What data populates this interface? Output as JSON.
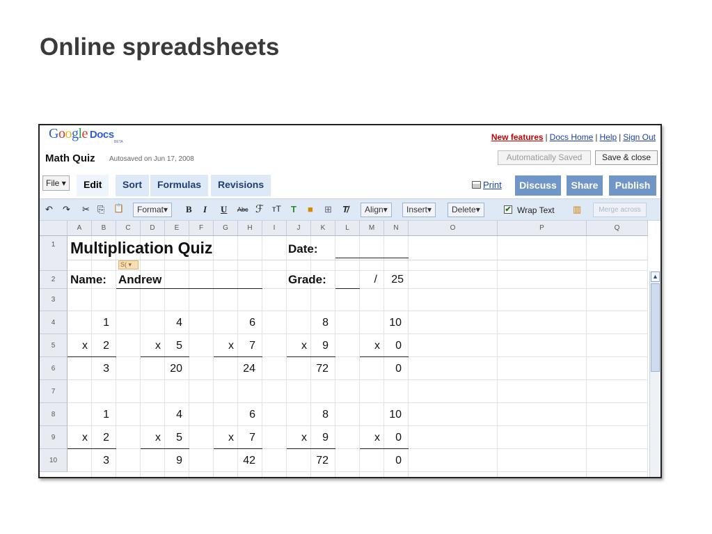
{
  "slide": {
    "title": "Online spreadsheets"
  },
  "app": {
    "logo": {
      "letters": [
        "G",
        "o",
        "o",
        "g",
        "l",
        "e"
      ],
      "docs": "Docs",
      "beta": "BETA"
    },
    "doc_title": "Math Quiz",
    "autosaved": "Autosaved on Jun 17, 2008",
    "links": {
      "new_features": "New features",
      "docs_home": "Docs Home",
      "help": "Help",
      "sign_out": "Sign Out",
      "separator": "|"
    },
    "auto_saved_button": "Automatically Saved",
    "save_close_button": "Save & close",
    "file_menu": "File",
    "tabs": [
      "Edit",
      "Sort",
      "Formulas",
      "Revisions"
    ],
    "print": "Print",
    "action_buttons": [
      "Discuss",
      "Share",
      "Publish"
    ],
    "toolbar": {
      "undo": "↶",
      "redo": "↷",
      "cut": "✂",
      "copy": "⎘",
      "paste": "📋",
      "format": "Format",
      "bold": "B",
      "italic": "I",
      "underline": "U",
      "strike": "Abc",
      "font": "ℱ",
      "font_size": "тT",
      "text_color": "T",
      "bg_color": "■",
      "borders": "⊞",
      "clear": "T̸",
      "align": "Align",
      "insert": "Insert",
      "delete": "Delete",
      "wrap_text": "Wrap Text",
      "checkmark": "✔",
      "chart": "▥",
      "merge_across": "Merge across",
      "dropdown": "▾"
    },
    "sort_badge": "S( ▾",
    "columns": [
      "A",
      "B",
      "C",
      "D",
      "E",
      "F",
      "G",
      "H",
      "I",
      "J",
      "K",
      "L",
      "M",
      "N",
      "O",
      "P",
      "Q"
    ],
    "rows": [
      "1",
      "2",
      "3",
      "4",
      "5",
      "6",
      "7",
      "8",
      "9",
      "10"
    ],
    "sheet": {
      "title": "Multiplication Quiz",
      "date_label": "Date:",
      "name_label": "Name:",
      "name_value": "Andrew",
      "grade_label": "Grade:",
      "grade_slash": "/",
      "grade_total": "25",
      "block1": {
        "row4": [
          "1",
          "4",
          "6",
          "8",
          "10"
        ],
        "row5": [
          "2",
          "5",
          "7",
          "9",
          "0"
        ],
        "row6": [
          "3",
          "20",
          "24",
          "72",
          "0"
        ]
      },
      "block2": {
        "row8": [
          "1",
          "4",
          "6",
          "8",
          "10"
        ],
        "row9": [
          "2",
          "5",
          "7",
          "9",
          "0"
        ],
        "row10": [
          "3",
          "9",
          "42",
          "72",
          "0"
        ]
      },
      "times": "x"
    },
    "scroll_up": "▲"
  }
}
